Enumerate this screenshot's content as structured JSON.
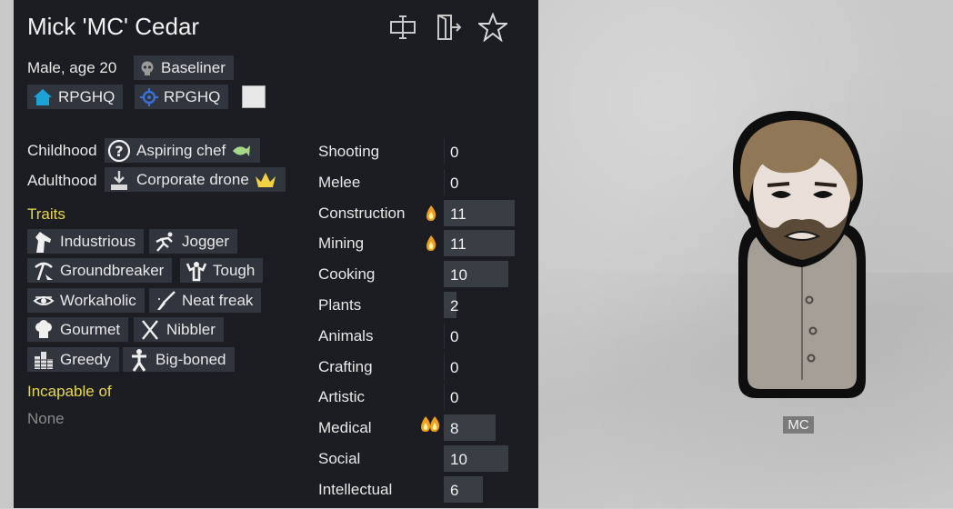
{
  "pawn": {
    "name": "Mick 'MC' Cedar",
    "sex_age": "Male, age 20",
    "xenotype": "Baseliner",
    "faction": "RPGHQ",
    "ideo": "RPGHQ",
    "map_label": "MC"
  },
  "backstory": {
    "childhood_label": "Childhood",
    "childhood": "Aspiring chef",
    "adulthood_label": "Adulthood",
    "adulthood": "Corporate drone"
  },
  "traits": {
    "title": "Traits",
    "items": [
      "Industrious",
      "Jogger",
      "Groundbreaker",
      "Tough",
      "Workaholic",
      "Neat freak",
      "Gourmet",
      "Nibbler",
      "Greedy",
      "Big-boned"
    ]
  },
  "incapable": {
    "title": "Incapable of",
    "value": "None"
  },
  "skills": [
    {
      "name": "Shooting",
      "level": "0",
      "passion": "none"
    },
    {
      "name": "Melee",
      "level": "0",
      "passion": "none"
    },
    {
      "name": "Construction",
      "level": "11",
      "passion": "minor"
    },
    {
      "name": "Mining",
      "level": "11",
      "passion": "minor"
    },
    {
      "name": "Cooking",
      "level": "10",
      "passion": "none"
    },
    {
      "name": "Plants",
      "level": "2",
      "passion": "none"
    },
    {
      "name": "Animals",
      "level": "0",
      "passion": "none"
    },
    {
      "name": "Crafting",
      "level": "0",
      "passion": "none"
    },
    {
      "name": "Artistic",
      "level": "0",
      "passion": "none"
    },
    {
      "name": "Medical",
      "level": "8",
      "passion": "major"
    },
    {
      "name": "Social",
      "level": "10",
      "passion": "none"
    },
    {
      "name": "Intellectual",
      "level": "6",
      "passion": "none"
    }
  ],
  "icons": {
    "header": [
      "rename-icon",
      "banish-icon",
      "favorite-star-icon"
    ],
    "faction": "house-icon",
    "ideo": "ideo-gear-icon",
    "xenotype": "skull-icon"
  },
  "colors": {
    "panel_bg": "#1b1d22",
    "chip_bg": "#31353d",
    "section_title": "#e6d84a",
    "faction_color": "#1ba3d6",
    "ideo_color": "#3b6fd6"
  }
}
